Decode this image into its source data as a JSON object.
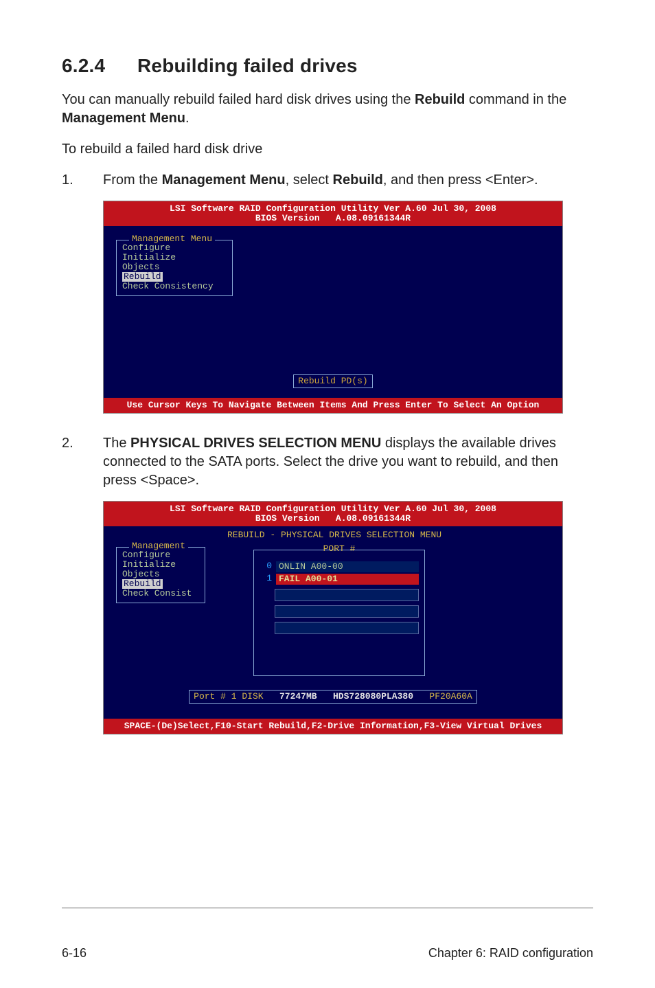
{
  "heading": {
    "number": "6.2.4",
    "title": "Rebuilding failed drives"
  },
  "intro_1_a": "You can manually rebuild failed hard disk drives using the ",
  "intro_1_b": "Rebuild",
  "intro_1_c": " command in the ",
  "intro_1_d": "Management Menu",
  "intro_1_e": ".",
  "intro_2": "To rebuild a failed hard disk drive",
  "step1": {
    "num": "1.",
    "a": "From the ",
    "b": "Management Menu",
    "c": ", select ",
    "d": "Rebuild",
    "e": ", and then press <Enter>."
  },
  "bios1": {
    "top1": "LSI Software RAID Configuration Utility Ver A.60 Jul 30, 2008",
    "top2": "BIOS Version   A.08.09161344R",
    "menu_title": "Management Menu",
    "items": [
      "Configure",
      "Initialize",
      "Objects",
      "Rebuild",
      "Check Consistency"
    ],
    "selected_index": 3,
    "center": "Rebuild PD(s)",
    "foot": "Use Cursor Keys To Navigate Between Items And Press Enter To Select An Option"
  },
  "step2": {
    "num": "2.",
    "a": "The ",
    "b": "PHYSICAL DRIVES SELECTION MENU",
    "c": " displays the available drives connected to the SATA ports. Select the drive you want to rebuild, and then press <Space>."
  },
  "bios2": {
    "top1": "LSI Software RAID Configuration Utility Ver A.60 Jul 30, 2008",
    "top2": "BIOS Version   A.08.09161344R",
    "subtitle": "REBUILD - PHYSICAL DRIVES SELECTION MENU",
    "menu_title": "Management",
    "items": [
      "Configure",
      "Initialize",
      "Objects",
      "Rebuild",
      "Check Consist"
    ],
    "selected_index": 3,
    "port_title": "PORT #",
    "ports": [
      {
        "idx": "0",
        "label": "ONLIN A00-00",
        "sel": false
      },
      {
        "idx": "1",
        "label": "FAIL  A00-01",
        "sel": true
      }
    ],
    "drive_port": "Port # 1 DISK",
    "drive_size": "77247MB",
    "drive_model": "HDS728080PLA380",
    "drive_fw": "PF20A60A",
    "foot": "SPACE-(De)Select,F10-Start Rebuild,F2-Drive Information,F3-View Virtual Drives"
  },
  "footer": {
    "left": "6-16",
    "right": "Chapter 6: RAID configuration"
  }
}
